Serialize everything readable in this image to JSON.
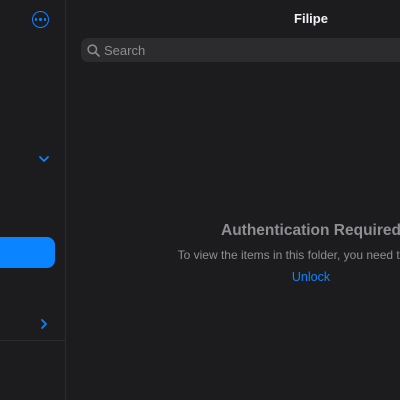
{
  "colors": {
    "accent": "#0a84ff",
    "background": "#1c1c1e",
    "search_background": "#2c2c2e",
    "secondary_text": "#8e8e93"
  },
  "sidebar": {
    "more_icon": "ellipsis-circle-icon",
    "collapse_icon": "chevron-down-icon",
    "forward_icon": "chevron-right-icon"
  },
  "header": {
    "title": "Filipe"
  },
  "search": {
    "icon": "magnifying-glass-icon",
    "placeholder": "Search",
    "value": ""
  },
  "empty_state": {
    "title": "Authentication Required",
    "message": "To view the items in this folder, you need to unlock",
    "action_label": "Unlock"
  }
}
